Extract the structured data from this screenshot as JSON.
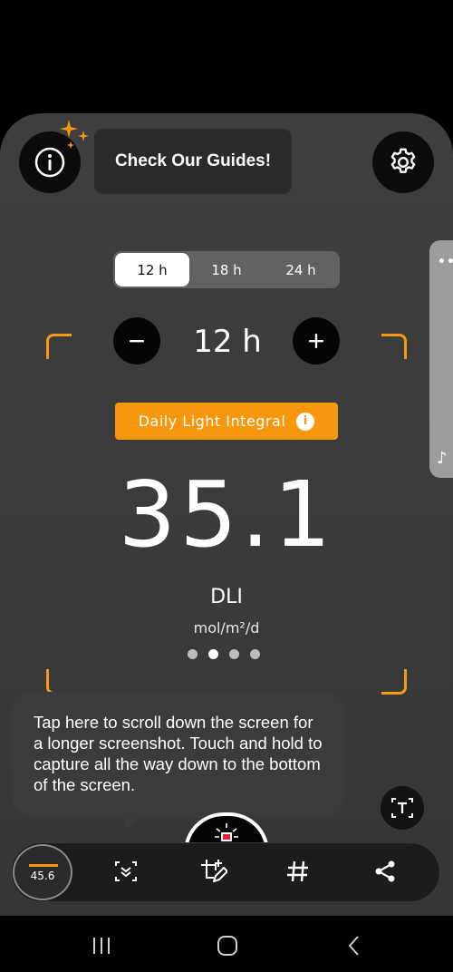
{
  "guides": {
    "label": "Check Our Guides!"
  },
  "photoperiod": {
    "options": [
      "12 h",
      "18 h",
      "24 h"
    ],
    "selected": "12 h",
    "value": "12 h"
  },
  "metric": {
    "label": "Daily Light Integral",
    "value": "35.1",
    "unit": "DLI",
    "unit_detail": "mol/m²/d",
    "page_count": 4,
    "page_index": 1
  },
  "screenshot_tip": {
    "text": "Tap here to scroll down the screen for a longer screenshot. Touch and hold to capture all the way down to the bottom of the screen."
  },
  "thumbnail": {
    "value": "45.6"
  },
  "colors": {
    "accent": "#f7970e",
    "card": "#3e3e3e",
    "toolbar": "#1c1c1c"
  },
  "icons": {
    "info": "info-icon",
    "settings": "gear-icon",
    "sparkles": "sparkles-icon",
    "minus": "minus-icon",
    "plus": "plus-icon",
    "text_extract": "text-extract-icon",
    "scroll_capture": "scroll-capture-icon",
    "edit": "crop-edit-icon",
    "tag": "hashtag-icon",
    "share": "share-icon"
  }
}
